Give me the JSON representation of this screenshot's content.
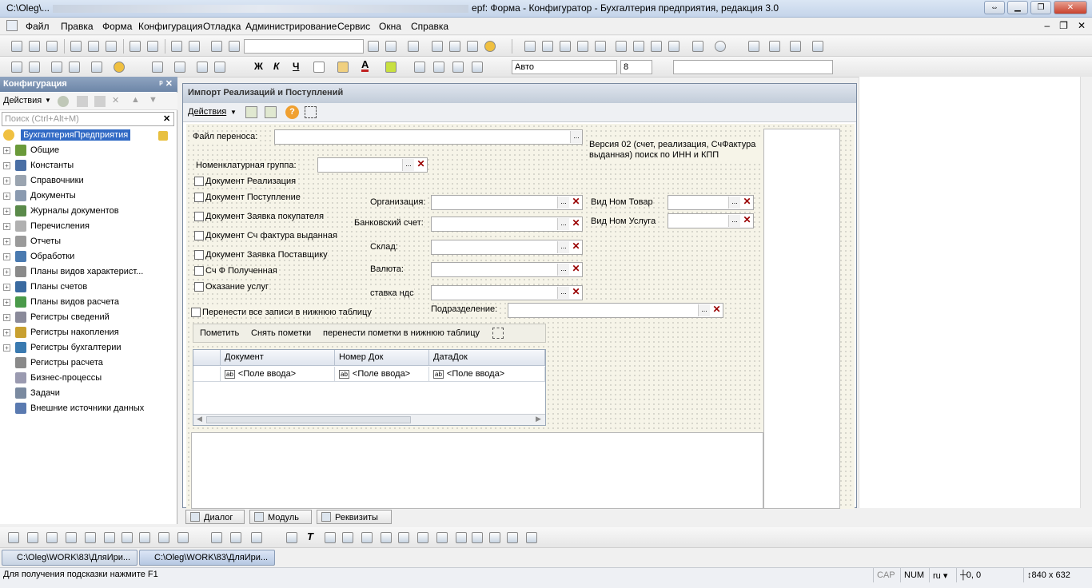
{
  "window": {
    "title_prefix": "C:\\Oleg\\...",
    "title_suffix": "epf: Форма - Конфигуратор - Бухгалтерия предприятия, редакция 3.0"
  },
  "menu": [
    "Файл",
    "Правка",
    "Форма",
    "Конфигурация",
    "Отладка",
    "Администрирование",
    "Сервис",
    "Окна",
    "Справка"
  ],
  "toolbar2": {
    "font_name": "Авто",
    "font_size": "8",
    "bold": "Ж",
    "italic": "К",
    "underline": "Ч"
  },
  "config_panel": {
    "title": "Конфигурация",
    "actions_label": "Действия",
    "search_placeholder": "Поиск (Ctrl+Alt+M)",
    "root": "БухгалтерияПредприятия",
    "items": [
      {
        "label": "Общие",
        "icon": "common-icon",
        "color": "#6a9a3a"
      },
      {
        "label": "Константы",
        "icon": "constants-icon",
        "color": "#4a6fa5"
      },
      {
        "label": "Справочники",
        "icon": "catalogs-icon",
        "color": "#9aa4b0"
      },
      {
        "label": "Документы",
        "icon": "documents-icon",
        "color": "#8a9ab0"
      },
      {
        "label": "Журналы документов",
        "icon": "journals-icon",
        "color": "#5a8a4a"
      },
      {
        "label": "Перечисления",
        "icon": "enums-icon",
        "color": "#b0b0b0"
      },
      {
        "label": "Отчеты",
        "icon": "reports-icon",
        "color": "#9a9a9a"
      },
      {
        "label": "Обработки",
        "icon": "processing-icon",
        "color": "#4a7ab0"
      },
      {
        "label": "Планы видов характерист...",
        "icon": "char-plans-icon",
        "color": "#8a8a8a"
      },
      {
        "label": "Планы счетов",
        "icon": "accounts-plan-icon",
        "color": "#3a6aa0"
      },
      {
        "label": "Планы видов расчета",
        "icon": "calc-plans-icon",
        "color": "#4a9a4a"
      },
      {
        "label": "Регистры сведений",
        "icon": "info-registers-icon",
        "color": "#8a8a9a"
      },
      {
        "label": "Регистры накопления",
        "icon": "accum-registers-icon",
        "color": "#c8a030"
      },
      {
        "label": "Регистры бухгалтерии",
        "icon": "acc-registers-icon",
        "color": "#3a7ab0"
      },
      {
        "label": "Регистры расчета",
        "icon": "calc-registers-icon",
        "color": "#8a8a8a"
      },
      {
        "label": "Бизнес-процессы",
        "icon": "business-process-icon",
        "color": "#9a9ab0"
      },
      {
        "label": "Задачи",
        "icon": "tasks-icon",
        "color": "#7a8aa0"
      },
      {
        "label": "Внешние источники данных",
        "icon": "external-sources-icon",
        "color": "#5a7ab0"
      }
    ]
  },
  "form": {
    "title": "Импорт Реализаций и Поступлений",
    "actions_label": "Действия",
    "file_label": "Файл переноса:",
    "version_note": "Версия 02 (счет, реализация, СчФактура выданная) поиск по ИНН и КПП",
    "nomen_group_label": "Номенклатурная группа:",
    "checkboxes": [
      "Документ Реализация",
      "Документ Поступление",
      "Документ Заявка покупателя",
      "Документ Сч фактура выданная",
      "Документ Заявка Поставщику",
      "Сч Ф Полученная",
      "Оказание услуг"
    ],
    "transfer_all": "Перенести все записи в нижнюю таблицу",
    "fields": {
      "org": "Организация:",
      "bank": "Банковский счет:",
      "warehouse": "Склад:",
      "currency": "Валюта:",
      "vat": "ставка ндс",
      "subdivision": "Подразделение:",
      "nom_goods": "Вид Ном Товар",
      "nom_service": "Вид Ном Услуга"
    },
    "table_buttons": [
      "Пометить",
      "Снять пометки",
      "перенести пометки в нижнюю таблицу"
    ],
    "grid_columns": [
      "Документ",
      "Номер Док",
      "ДатаДок"
    ],
    "grid_row": [
      "<Поле ввода>",
      "<Поле ввода>",
      "<Поле ввода>"
    ],
    "tabs": [
      "Диалог",
      "Модуль",
      "Реквизиты"
    ]
  },
  "taskbar": [
    "C:\\Oleg\\WORK\\83\\ДляИри...",
    "C:\\Oleg\\WORK\\83\\ДляИри..."
  ],
  "status": {
    "hint": "Для получения подсказки нажмите F1",
    "cap": "CAP",
    "num": "NUM",
    "lang": "ru",
    "pos": "0, 0",
    "size": "840 x 632"
  }
}
